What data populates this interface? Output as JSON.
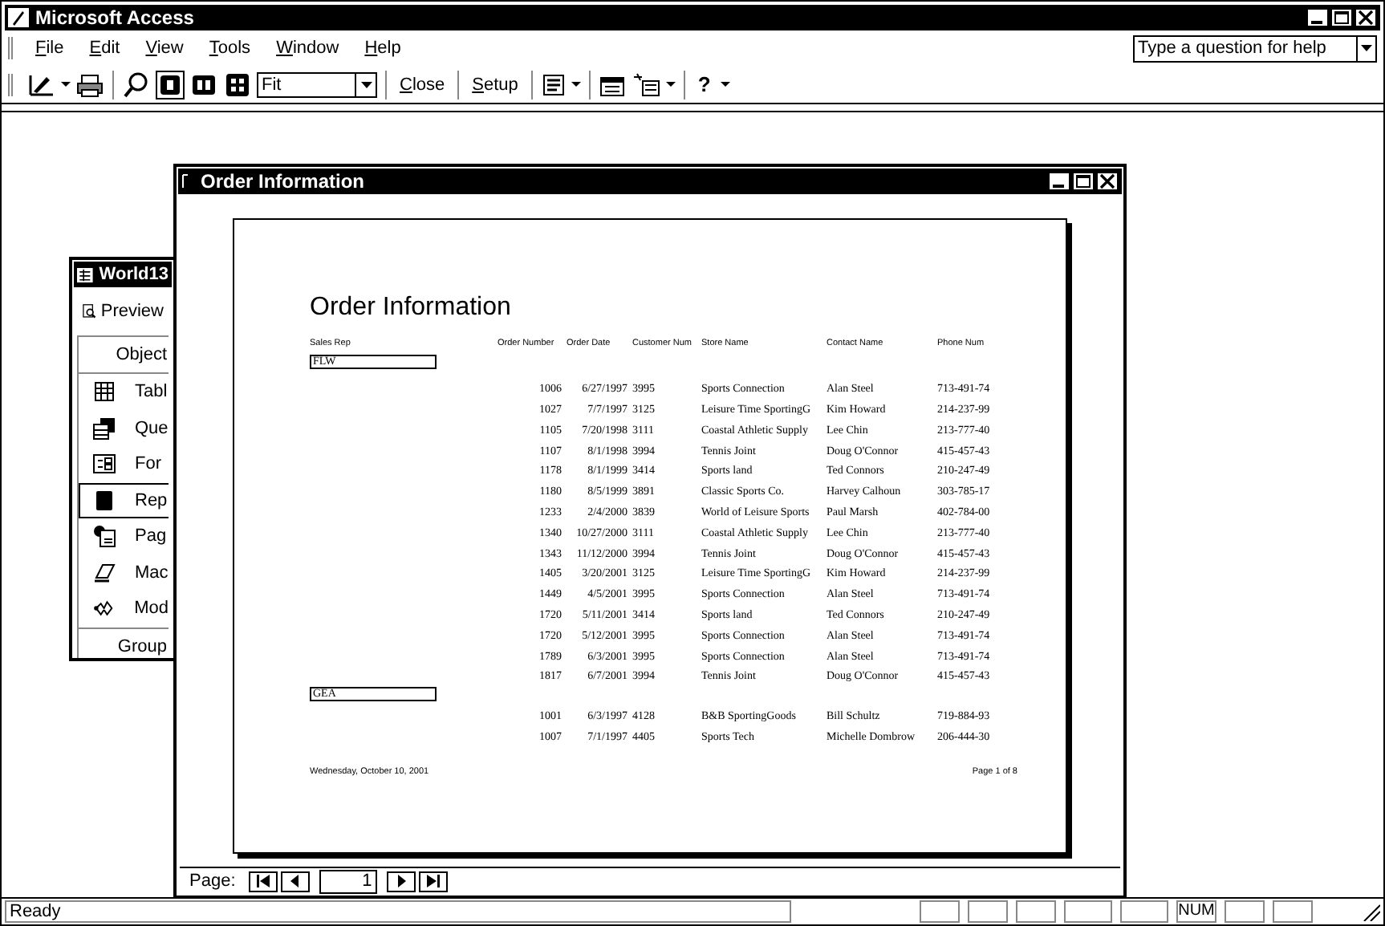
{
  "window": {
    "title": "Microsoft Access"
  },
  "menu": [
    "File",
    "Edit",
    "View",
    "Tools",
    "Window",
    "Help"
  ],
  "help_box": {
    "placeholder": "Type a question for help"
  },
  "toolbar": {
    "zoom_value": "Fit",
    "buttons": [
      "Close",
      "Setup"
    ],
    "help_glyph": "?"
  },
  "database_window": {
    "title": "World13",
    "preview": "Preview",
    "objects_header": "Object",
    "groups_header": "Group",
    "objects": [
      {
        "label": "Tabl",
        "selected": false
      },
      {
        "label": "Que",
        "selected": false
      },
      {
        "label": "For",
        "selected": false
      },
      {
        "label": "Rep",
        "selected": true
      },
      {
        "label": "Pag",
        "selected": false
      },
      {
        "label": "Mac",
        "selected": false
      },
      {
        "label": "Mod",
        "selected": false
      }
    ]
  },
  "report_window": {
    "title": "Order Information",
    "report": {
      "title": "Order Information",
      "columns": [
        "Sales Rep",
        "Order Number",
        "Order Date",
        "Customer Num",
        "Store Name",
        "Contact Name",
        "Phone Num"
      ],
      "groups": [
        {
          "sales_rep": "FLW",
          "rows": [
            [
              "1006",
              "6/27/1997",
              "3995",
              "Sports Connection",
              "Alan Steel",
              "713-491-74"
            ],
            [
              "1027",
              "7/7/1997",
              "3125",
              "Leisure Time SportingG",
              "Kim Howard",
              "214-237-99"
            ],
            [
              "1105",
              "7/20/1998",
              "3111",
              "Coastal Athletic Supply",
              "Lee Chin",
              "213-777-40"
            ],
            [
              "1107",
              "8/1/1998",
              "3994",
              "Tennis Joint",
              "Doug O'Connor",
              "415-457-43"
            ],
            [
              "1178",
              "8/1/1999",
              "3414",
              "Sports land",
              "Ted Connors",
              "210-247-49"
            ],
            [
              "1180",
              "8/5/1999",
              "3891",
              "Classic Sports Co.",
              "Harvey Calhoun",
              "303-785-17"
            ],
            [
              "1233",
              "2/4/2000",
              "3839",
              "World of Leisure Sports",
              "Paul Marsh",
              "402-784-00"
            ],
            [
              "1340",
              "10/27/2000",
              "3111",
              "Coastal Athletic Supply",
              "Lee Chin",
              "213-777-40"
            ],
            [
              "1343",
              "11/12/2000",
              "3994",
              "Tennis Joint",
              "Doug O'Connor",
              "415-457-43"
            ],
            [
              "1405",
              "3/20/2001",
              "3125",
              "Leisure Time SportingG",
              "Kim Howard",
              "214-237-99"
            ],
            [
              "1449",
              "4/5/2001",
              "3995",
              "Sports Connection",
              "Alan Steel",
              "713-491-74"
            ],
            [
              "1720",
              "5/11/2001",
              "3414",
              "Sports land",
              "Ted Connors",
              "210-247-49"
            ],
            [
              "1720",
              "5/12/2001",
              "3995",
              "Sports Connection",
              "Alan Steel",
              "713-491-74"
            ],
            [
              "1789",
              "6/3/2001",
              "3995",
              "Sports Connection",
              "Alan Steel",
              "713-491-74"
            ],
            [
              "1817",
              "6/7/2001",
              "3994",
              "Tennis Joint",
              "Doug O'Connor",
              "415-457-43"
            ]
          ]
        },
        {
          "sales_rep": "GEA",
          "rows": [
            [
              "1001",
              "6/3/1997",
              "4128",
              "B&B SportingGoods",
              "Bill Schultz",
              "719-884-93"
            ],
            [
              "1007",
              "7/1/1997",
              "4405",
              "Sports Tech",
              "Michelle Dombrow",
              "206-444-30"
            ]
          ]
        }
      ],
      "footer_date": "Wednesday, October 10, 2001",
      "footer_page": "Page 1 of 8"
    },
    "nav_label": "Page:",
    "page_value": "1"
  },
  "status_bar": {
    "text": "Ready",
    "num_indicator": "NUM"
  }
}
